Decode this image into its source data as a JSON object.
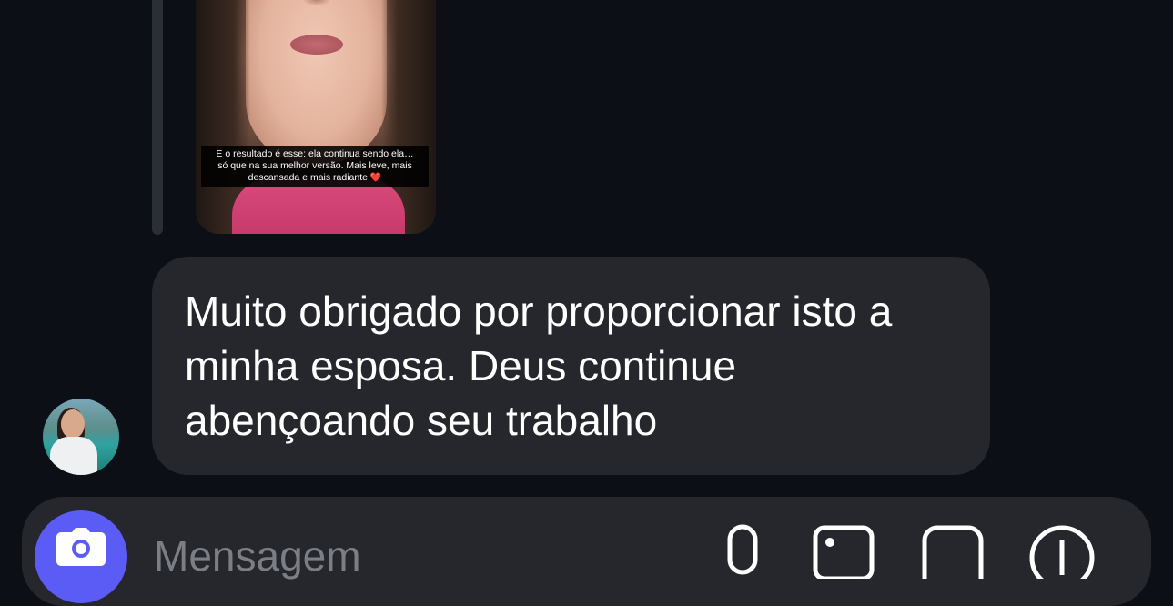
{
  "story": {
    "caption_line1": "E o resultado é esse: ela continua sendo ela…",
    "caption_line2": "só que na sua melhor versão. Mais leve, mais",
    "caption_line3": "descansada e mais radiante",
    "heart": "❤️"
  },
  "message": {
    "text": "Muito obrigado por proporcionar isto a minha esposa. Deus continue abençoando seu trabalho"
  },
  "composer": {
    "placeholder": "Mensagem"
  },
  "icons": {
    "camera": "camera-icon",
    "mic": "microphone-icon",
    "gallery": "image-icon",
    "sticker": "sticker-icon",
    "plus": "plus-icon"
  },
  "colors": {
    "background": "#0c1016",
    "bubble": "#25272d",
    "accent": "#5b5bf5"
  }
}
